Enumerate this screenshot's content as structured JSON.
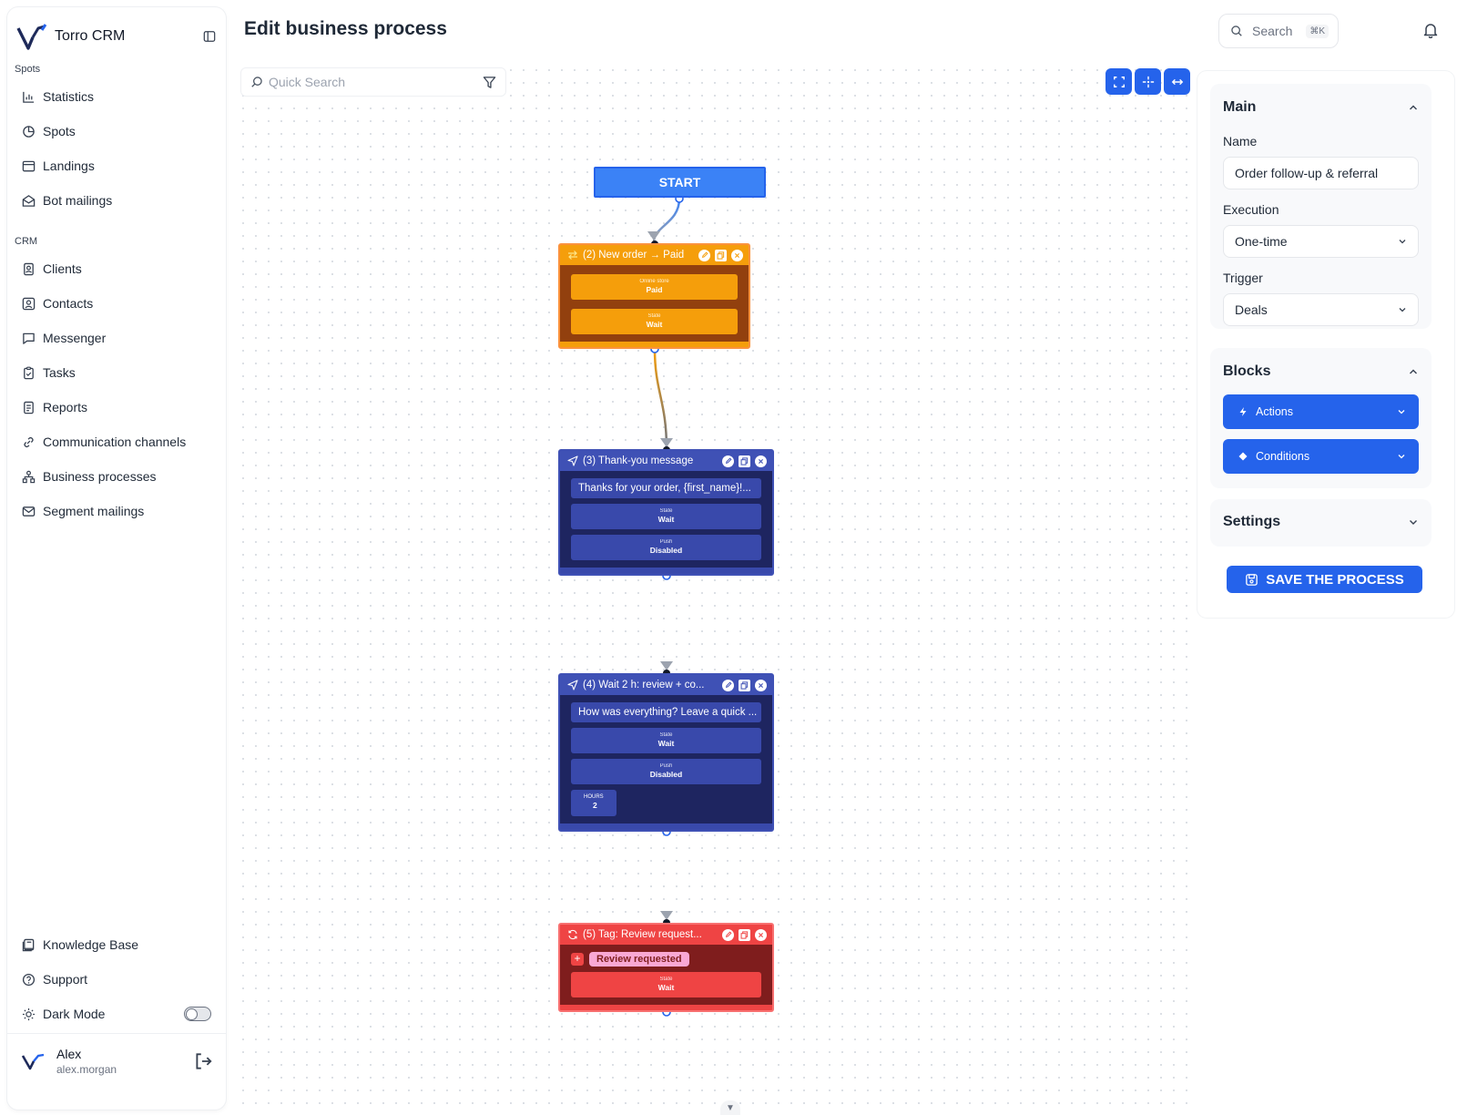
{
  "app": {
    "name": "Torro CRM"
  },
  "sidebar": {
    "sections": [
      {
        "label": "Spots",
        "items": [
          {
            "label": "Statistics",
            "icon": "bar-chart-icon"
          },
          {
            "label": "Spots",
            "icon": "pie-chart-icon"
          },
          {
            "label": "Landings",
            "icon": "browser-window-icon"
          },
          {
            "label": "Bot mailings",
            "icon": "mail-open-icon"
          }
        ]
      },
      {
        "label": "CRM",
        "items": [
          {
            "label": "Clients",
            "icon": "contact-book-icon"
          },
          {
            "label": "Contacts",
            "icon": "user-square-icon"
          },
          {
            "label": "Messenger",
            "icon": "chat-bubble-icon"
          },
          {
            "label": "Tasks",
            "icon": "clipboard-icon"
          },
          {
            "label": "Reports",
            "icon": "report-icon"
          },
          {
            "label": "Communication channels",
            "icon": "link-icon"
          },
          {
            "label": "Business processes",
            "icon": "workflow-icon"
          },
          {
            "label": "Segment mailings",
            "icon": "envelope-icon"
          }
        ]
      }
    ],
    "bottom": [
      {
        "label": "Knowledge Base",
        "icon": "book-icon"
      },
      {
        "label": "Support",
        "icon": "help-circle-icon"
      },
      {
        "label": "Dark Mode",
        "icon": "sun-icon"
      }
    ],
    "dark_mode_on": false,
    "user": {
      "name": "Alex",
      "login": "alex.morgan"
    }
  },
  "header": {
    "title": "Edit business process",
    "search_placeholder": "Search",
    "search_shortcut": "⌘K"
  },
  "canvas": {
    "quick_search_placeholder": "Quick Search",
    "start_label": "START",
    "nodes": [
      {
        "title": "(2) New order → Paid",
        "color": "#f59e0b",
        "fields": [
          {
            "label": "Online store",
            "value": "Paid"
          },
          {
            "label": "State",
            "value": "Wait"
          }
        ]
      },
      {
        "title": "(3) Thank-you message",
        "color": "#3f51b5",
        "message": "Thanks for your order, {first_name}!...",
        "fields": [
          {
            "label": "State",
            "value": "Wait"
          },
          {
            "label": "Push",
            "value": "Disabled"
          }
        ]
      },
      {
        "title": "(4) Wait 2 h: review + co...",
        "color": "#3f51b5",
        "message": "How was everything? Leave a quick ...",
        "fields": [
          {
            "label": "State",
            "value": "Wait"
          },
          {
            "label": "Push",
            "value": "Disabled"
          }
        ],
        "hours": {
          "label": "HOURS",
          "value": "2"
        }
      },
      {
        "title": "(5) Tag: Review request...",
        "color": "#ef4444",
        "tag": "Review requested",
        "fields": [
          {
            "label": "State",
            "value": "Wait"
          }
        ]
      }
    ]
  },
  "panel": {
    "main": {
      "title": "Main",
      "name_label": "Name",
      "name_value": "Order follow-up & referral",
      "execution_label": "Execution",
      "execution_value": "One-time",
      "trigger_label": "Trigger",
      "trigger_value": "Deals"
    },
    "blocks": {
      "title": "Blocks",
      "actions_label": "Actions",
      "conditions_label": "Conditions"
    },
    "settings": {
      "title": "Settings"
    },
    "save_label": "SAVE THE PROCESS"
  },
  "colors": {
    "accent": "#2563eb",
    "orange": "#f59e0b",
    "indigo": "#3f51b5",
    "red": "#ef4444"
  }
}
